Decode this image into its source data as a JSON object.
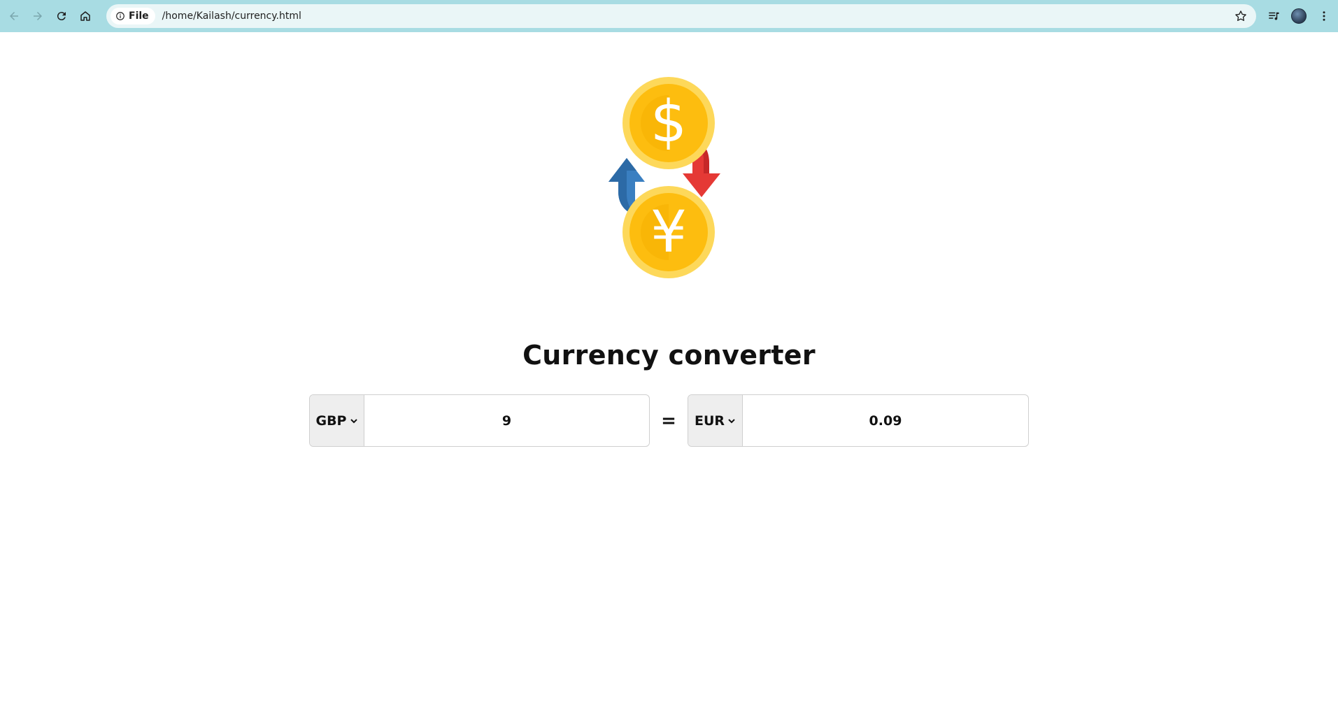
{
  "browser": {
    "site_chip_label": "File",
    "url": "/home/Kailash/currency.html"
  },
  "page": {
    "title": "Currency converter",
    "logo_icon": "currency-exchange-icon"
  },
  "converter": {
    "from_currency": "GBP",
    "from_amount": "9",
    "equals_sign": "=",
    "to_currency": "EUR",
    "to_amount": "0.09"
  },
  "colors": {
    "chrome_bg": "#a8dce3",
    "coin_outer": "#fdd85a",
    "coin_inner": "#fdbd0f",
    "arrow_up": "#3a7fc1",
    "arrow_down": "#e53935"
  }
}
